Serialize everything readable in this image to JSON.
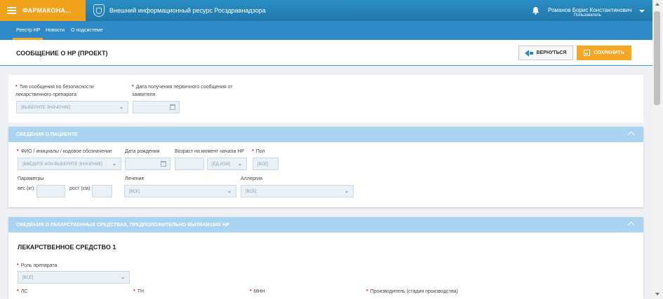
{
  "app": {
    "brand": "ФАРМАКОНА...",
    "resource_title": "Внешний информационный ресурс Росздравнадзора"
  },
  "user": {
    "name": "Романов Борис Константинович",
    "role": "Пользователь"
  },
  "nav": {
    "items": [
      {
        "label": "Реестр НР"
      },
      {
        "label": "Новости"
      },
      {
        "label": "О подсистеме"
      }
    ]
  },
  "page": {
    "title": "СООБЩЕНИЕ О НР (ПРОЕКТ)",
    "back_label": "ВЕРНУТЬСЯ",
    "save_label": "СОХРАНИТЬ"
  },
  "general": {
    "message_type_label": "Тип сообщения по безопасности лекарственного препарата",
    "message_type_value": "[ВЫБЕРИТЕ ЗНАЧЕНИЕ]",
    "date_received_label": "Дата получения первичного сообщения от заявителя",
    "date_received_value": ""
  },
  "patient": {
    "section_title": "СВЕДЕНИЯ О ПАЦИЕНТЕ",
    "fio_label": "ФИО / инициалы / кодовое обозначение",
    "fio_placeholder": "[ВВЕДИТЕ ИЛИ ВЫБЕРИТЕ ЗНАЧЕНИЕ]",
    "birth_label": "Дата рождения",
    "age_label": "Возраст на момент начала НР",
    "age_unit_value": "[ЕД.ИЗМ]",
    "sex_label": "Пол",
    "sex_value": "[ВСЕ]",
    "params_label": "Параметры",
    "weight_label": "вес (кг):",
    "height_label": "рост (см):",
    "treatment_label": "Лечение",
    "treatment_value": "[ВСЕ]",
    "allergy_label": "Аллергия",
    "allergy_value": "[ВСЕ]"
  },
  "drugs": {
    "section_title": "СВЕДЕНИЯ О ЛЕКАРСТВЕННЫХ СРЕДСТВАХ, ПРЕДПОЛОЖИТЕЛЬНО ВЫЗВАВШИХ НР",
    "drug_title": "ЛЕКАРСТВЕННОЕ СРЕДСТВО 1",
    "role_label": "Роль препарата",
    "role_value": "[ВСЕ]",
    "ls_label": "ЛС",
    "tn_label": "ТН",
    "mnn_label": "МНН",
    "manufacturer_label": "Производитель (стадия производства)"
  },
  "colors": {
    "header_blue": "#2077aa",
    "brand_orange": "#f0a21a",
    "section_head": "#a9d3f0",
    "save_orange": "#f5a623"
  },
  "icons": [
    "menu-icon",
    "emblem-icon",
    "bell-icon",
    "chevron-down-icon",
    "arrow-left-icon",
    "save-icon",
    "calendar-icon",
    "chevron-up-icon"
  ]
}
